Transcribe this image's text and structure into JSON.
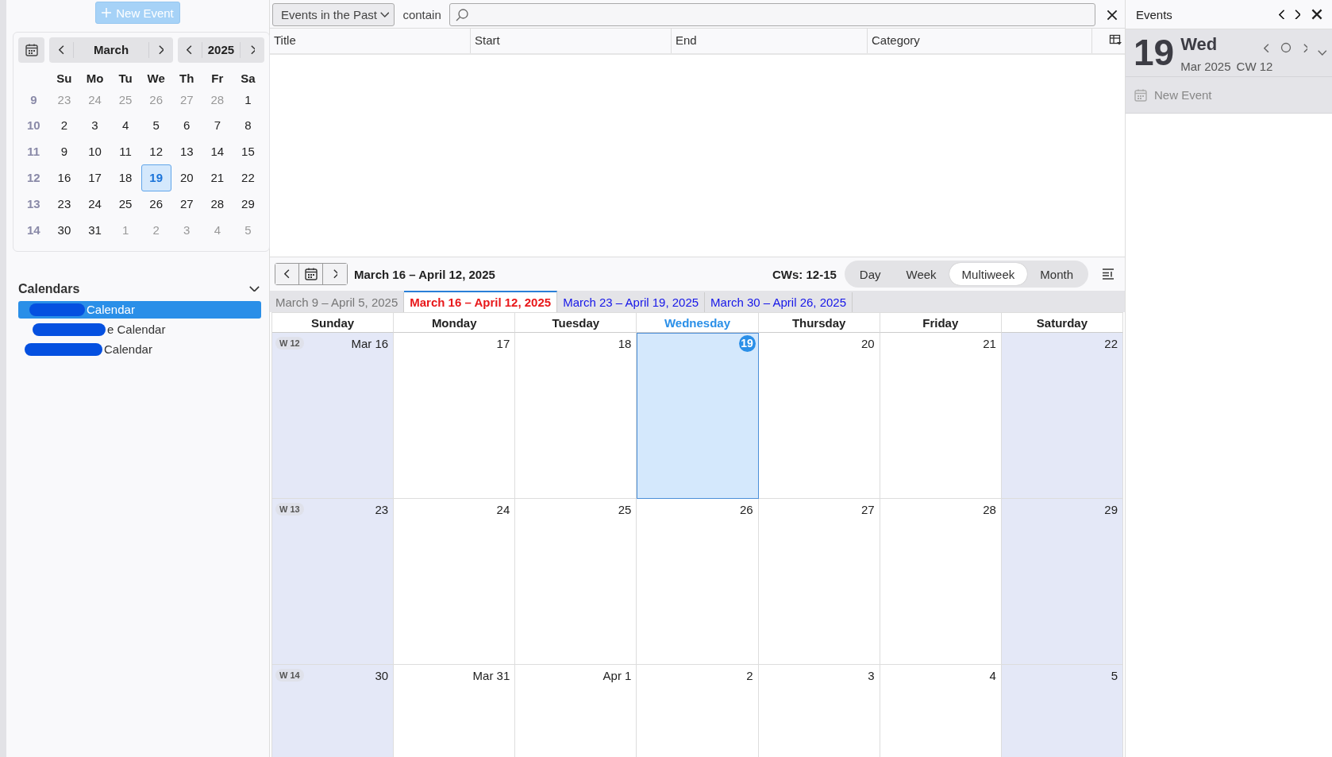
{
  "sidebar": {
    "new_event_button": "New Event",
    "minimonth": {
      "month": "March",
      "year": "2025",
      "weekdays": [
        "Su",
        "Mo",
        "Tu",
        "We",
        "Th",
        "Fr",
        "Sa"
      ],
      "weeks": [
        {
          "number": "9",
          "days": [
            {
              "label": "23",
              "other_month": true,
              "selected": false
            },
            {
              "label": "24",
              "other_month": true,
              "selected": false
            },
            {
              "label": "25",
              "other_month": true,
              "selected": false
            },
            {
              "label": "26",
              "other_month": true,
              "selected": false
            },
            {
              "label": "27",
              "other_month": true,
              "selected": false
            },
            {
              "label": "28",
              "other_month": true,
              "selected": false
            },
            {
              "label": "1",
              "other_month": false,
              "selected": false
            }
          ]
        },
        {
          "number": "10",
          "days": [
            {
              "label": "2",
              "other_month": false,
              "selected": false
            },
            {
              "label": "3",
              "other_month": false,
              "selected": false
            },
            {
              "label": "4",
              "other_month": false,
              "selected": false
            },
            {
              "label": "5",
              "other_month": false,
              "selected": false
            },
            {
              "label": "6",
              "other_month": false,
              "selected": false
            },
            {
              "label": "7",
              "other_month": false,
              "selected": false
            },
            {
              "label": "8",
              "other_month": false,
              "selected": false
            }
          ]
        },
        {
          "number": "11",
          "days": [
            {
              "label": "9",
              "other_month": false,
              "selected": false
            },
            {
              "label": "10",
              "other_month": false,
              "selected": false
            },
            {
              "label": "11",
              "other_month": false,
              "selected": false
            },
            {
              "label": "12",
              "other_month": false,
              "selected": false
            },
            {
              "label": "13",
              "other_month": false,
              "selected": false
            },
            {
              "label": "14",
              "other_month": false,
              "selected": false
            },
            {
              "label": "15",
              "other_month": false,
              "selected": false
            }
          ]
        },
        {
          "number": "12",
          "days": [
            {
              "label": "16",
              "other_month": false,
              "selected": false
            },
            {
              "label": "17",
              "other_month": false,
              "selected": false
            },
            {
              "label": "18",
              "other_month": false,
              "selected": false
            },
            {
              "label": "19",
              "other_month": false,
              "selected": true
            },
            {
              "label": "20",
              "other_month": false,
              "selected": false
            },
            {
              "label": "21",
              "other_month": false,
              "selected": false
            },
            {
              "label": "22",
              "other_month": false,
              "selected": false
            }
          ]
        },
        {
          "number": "13",
          "days": [
            {
              "label": "23",
              "other_month": false,
              "selected": false
            },
            {
              "label": "24",
              "other_month": false,
              "selected": false
            },
            {
              "label": "25",
              "other_month": false,
              "selected": false
            },
            {
              "label": "26",
              "other_month": false,
              "selected": false
            },
            {
              "label": "27",
              "other_month": false,
              "selected": false
            },
            {
              "label": "28",
              "other_month": false,
              "selected": false
            },
            {
              "label": "29",
              "other_month": false,
              "selected": false
            }
          ]
        },
        {
          "number": "14",
          "days": [
            {
              "label": "30",
              "other_month": false,
              "selected": false
            },
            {
              "label": "31",
              "other_month": false,
              "selected": false
            },
            {
              "label": "1",
              "other_month": true,
              "selected": false
            },
            {
              "label": "2",
              "other_month": true,
              "selected": false
            },
            {
              "label": "3",
              "other_month": true,
              "selected": false
            },
            {
              "label": "4",
              "other_month": true,
              "selected": false
            },
            {
              "label": "5",
              "other_month": true,
              "selected": false
            }
          ]
        }
      ]
    },
    "calendars": {
      "title": "Calendars",
      "items": [
        {
          "label": "Calendar",
          "selected": true
        },
        {
          "label": "e Calendar",
          "selected": false
        },
        {
          "label": "Calendar",
          "selected": false
        }
      ]
    }
  },
  "filter": {
    "dropdown": "Events in the Past",
    "match": "contain"
  },
  "event_list": {
    "columns": [
      "Title",
      "Start",
      "End",
      "Category"
    ]
  },
  "view": {
    "title": "March 16 – April 12, 2025",
    "cws": "CWs: 12-15",
    "modes": [
      {
        "label": "Day",
        "selected": false
      },
      {
        "label": "Week",
        "selected": false
      },
      {
        "label": "Multiweek",
        "selected": true
      },
      {
        "label": "Month",
        "selected": false
      }
    ],
    "tabs": [
      {
        "label": "March 9 – April 5, 2025",
        "past": true,
        "selected": false
      },
      {
        "label": "March 16 – April 12, 2025",
        "past": false,
        "selected": true
      },
      {
        "label": "March 23 – April 19, 2025",
        "past": false,
        "selected": false
      },
      {
        "label": "March 30 – April 26, 2025",
        "past": false,
        "selected": false
      }
    ],
    "weekdays": [
      {
        "label": "Sunday",
        "today": false
      },
      {
        "label": "Monday",
        "today": false
      },
      {
        "label": "Tuesday",
        "today": false
      },
      {
        "label": "Wednesday",
        "today": true
      },
      {
        "label": "Thursday",
        "today": false
      },
      {
        "label": "Friday",
        "today": false
      },
      {
        "label": "Saturday",
        "today": false
      }
    ],
    "weeks": [
      {
        "badge": "W 12",
        "days": [
          {
            "label": "Mar 16",
            "weekend": true,
            "today": false
          },
          {
            "label": "17",
            "weekend": false,
            "today": false
          },
          {
            "label": "18",
            "weekend": false,
            "today": false
          },
          {
            "label": "19",
            "weekend": false,
            "today": true
          },
          {
            "label": "20",
            "weekend": false,
            "today": false
          },
          {
            "label": "21",
            "weekend": false,
            "today": false
          },
          {
            "label": "22",
            "weekend": true,
            "today": false
          }
        ]
      },
      {
        "badge": "W 13",
        "days": [
          {
            "label": "23",
            "weekend": true,
            "today": false
          },
          {
            "label": "24",
            "weekend": false,
            "today": false
          },
          {
            "label": "25",
            "weekend": false,
            "today": false
          },
          {
            "label": "26",
            "weekend": false,
            "today": false
          },
          {
            "label": "27",
            "weekend": false,
            "today": false
          },
          {
            "label": "28",
            "weekend": false,
            "today": false
          },
          {
            "label": "29",
            "weekend": true,
            "today": false
          }
        ]
      },
      {
        "badge": "W 14",
        "days": [
          {
            "label": "30",
            "weekend": true,
            "today": false
          },
          {
            "label": "Mar 31",
            "weekend": false,
            "today": false
          },
          {
            "label": "Apr 1",
            "weekend": false,
            "today": false
          },
          {
            "label": "2",
            "weekend": false,
            "today": false
          },
          {
            "label": "3",
            "weekend": false,
            "today": false
          },
          {
            "label": "4",
            "weekend": false,
            "today": false
          },
          {
            "label": "5",
            "weekend": true,
            "today": false
          }
        ]
      }
    ]
  },
  "today_pane": {
    "title": "Events",
    "day": "19",
    "weekday": "Wed",
    "month_year": "Mar 2025",
    "week": "CW 12",
    "new_event": "New Event"
  }
}
